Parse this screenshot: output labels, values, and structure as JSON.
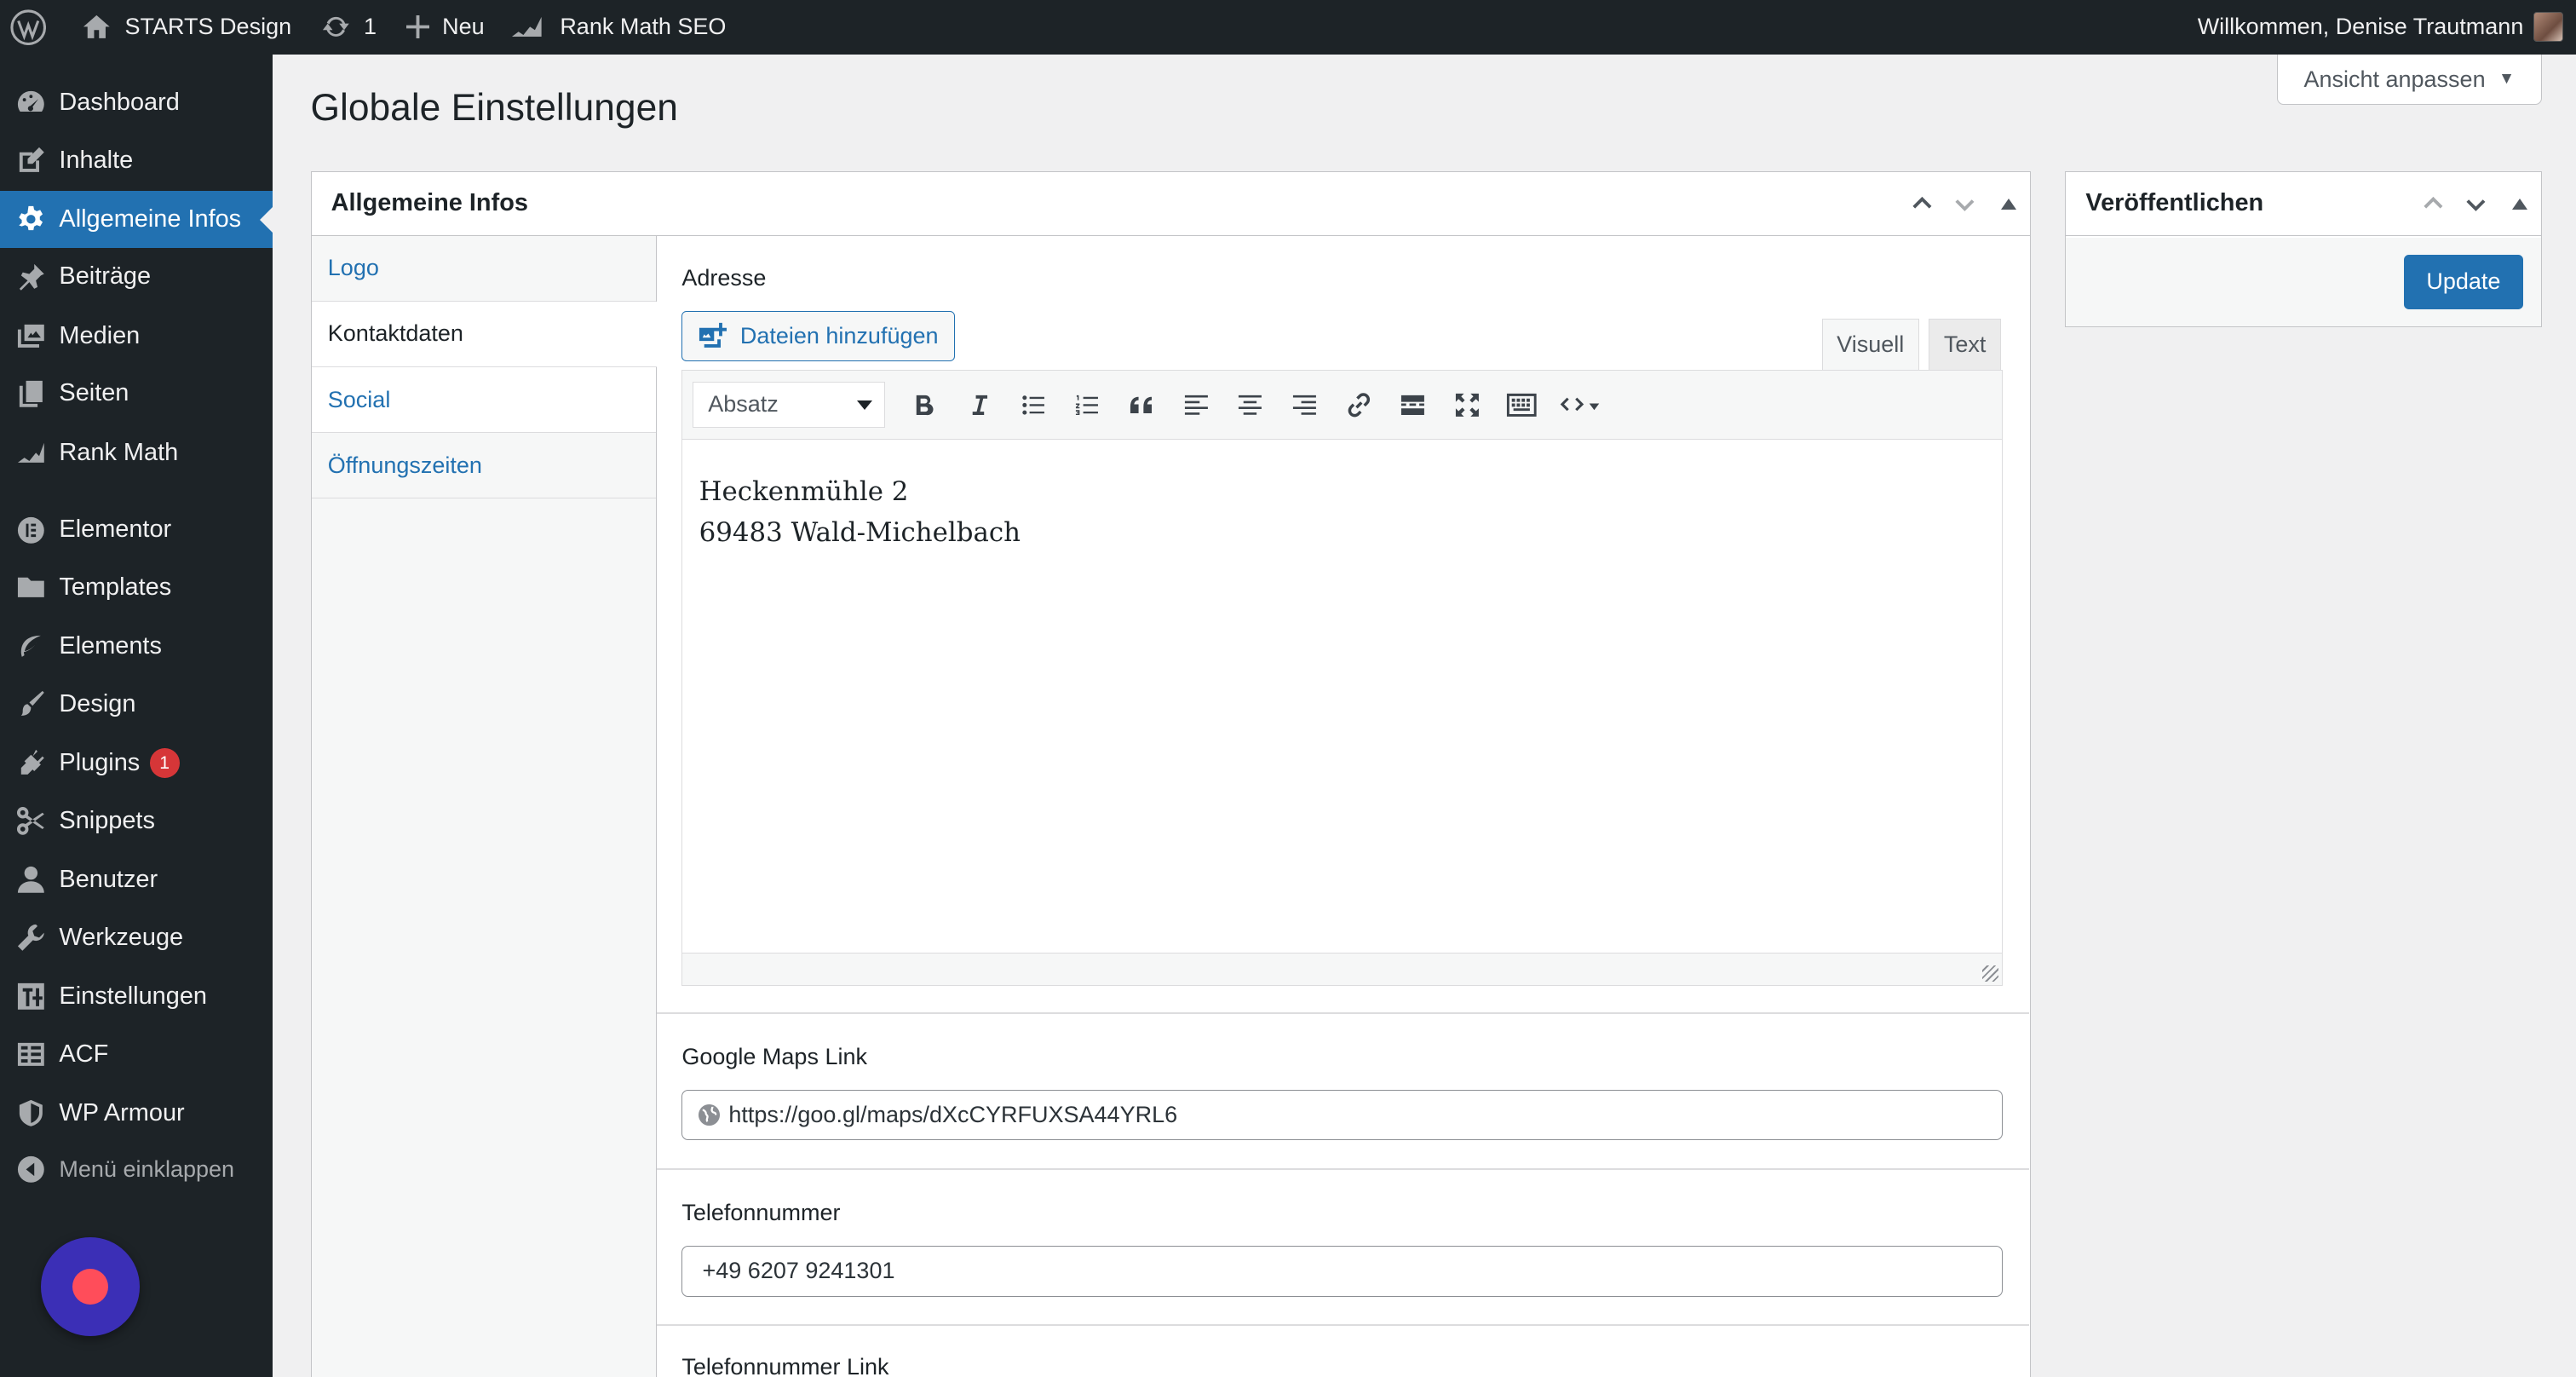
{
  "adminbar": {
    "site_name": "STARTS Design",
    "updates_count": "1",
    "new_label": "Neu",
    "seo_label": "Rank Math SEO",
    "greeting": "Willkommen, Denise Trautmann"
  },
  "sidebar": {
    "items": [
      {
        "label": "Dashboard",
        "icon": "dashboard-icon"
      },
      {
        "label": "Inhalte",
        "icon": "edit-icon"
      },
      {
        "label": "Allgemeine Infos",
        "icon": "gear-icon",
        "active": true
      },
      {
        "label": "Beiträge",
        "icon": "pin-icon"
      },
      {
        "label": "Medien",
        "icon": "media-icon"
      },
      {
        "label": "Seiten",
        "icon": "pages-icon"
      },
      {
        "label": "Rank Math",
        "icon": "chart-icon"
      },
      {
        "label": "Elementor",
        "icon": "elementor-icon"
      },
      {
        "label": "Templates",
        "icon": "folder-icon"
      },
      {
        "label": "Elements",
        "icon": "leaf-icon"
      },
      {
        "label": "Design",
        "icon": "brush-icon"
      },
      {
        "label": "Plugins",
        "icon": "plugin-icon",
        "badge": "1"
      },
      {
        "label": "Snippets",
        "icon": "scissors-icon"
      },
      {
        "label": "Benutzer",
        "icon": "user-icon"
      },
      {
        "label": "Werkzeuge",
        "icon": "wrench-icon"
      },
      {
        "label": "Einstellungen",
        "icon": "sliders-icon"
      },
      {
        "label": "ACF",
        "icon": "table-icon"
      },
      {
        "label": "WP Armour",
        "icon": "shield-icon"
      }
    ],
    "collapse_label": "Menü einklappen"
  },
  "screen_options": "Ansicht anpassen",
  "page_title": "Globale Einstellungen",
  "main_box": {
    "title": "Allgemeine Infos",
    "tabs": [
      "Logo",
      "Kontaktdaten",
      "Social",
      "Öffnungszeiten"
    ],
    "active_tab": "Kontaktdaten"
  },
  "address": {
    "label": "Adresse",
    "add_media": "Dateien hinzufügen",
    "tab_visual": "Visuell",
    "tab_text": "Text",
    "format": "Absatz",
    "line1": "Heckenmühle 2",
    "line2": "69483 Wald-Michelbach"
  },
  "maps": {
    "label": "Google Maps Link",
    "value": "https://goo.gl/maps/dXcCYRFUXSA44YRL6"
  },
  "phone": {
    "label": "Telefonnummer",
    "value": "+49 6207 9241301"
  },
  "phone_link": {
    "label": "Telefonnummer Link"
  },
  "publish_box": {
    "title": "Veröffentlichen",
    "update_label": "Update"
  },
  "colors": {
    "accent": "#2271b1",
    "admin_dark": "#1d2327",
    "badge": "#d63638"
  }
}
